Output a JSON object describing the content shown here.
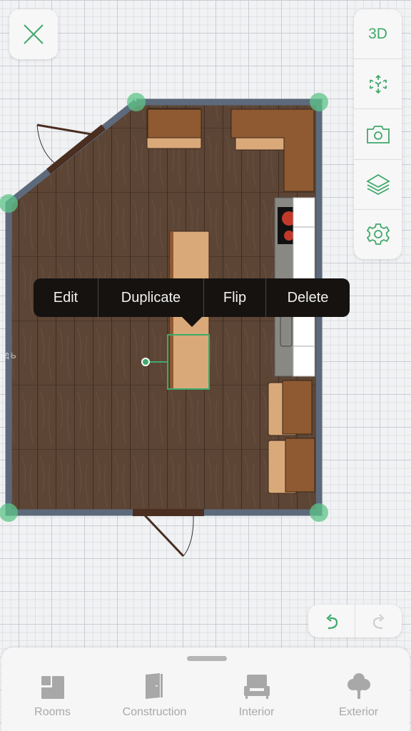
{
  "top_left": {
    "close_icon": "close-icon"
  },
  "toolbar": {
    "items": [
      {
        "label": "3D",
        "name": "view-3d"
      },
      {
        "icon": "move-3d-icon",
        "name": "transform"
      },
      {
        "icon": "camera-icon",
        "name": "snapshot"
      },
      {
        "icon": "layers-icon",
        "name": "layers"
      },
      {
        "icon": "gear-icon",
        "name": "settings"
      }
    ]
  },
  "floor_plan": {
    "wall_dimension_label": "15' 0\"",
    "colors": {
      "floor": "#5c4535",
      "wall": "#5d6a7b",
      "vertex": "#5ec48a",
      "cabinet_top": "#8f5a31",
      "counter": "#d9a97a",
      "selection": "#3fa96b"
    }
  },
  "context_menu": {
    "items": [
      "Edit",
      "Duplicate",
      "Flip",
      "Delete"
    ]
  },
  "history": {
    "undo_icon": "undo-icon",
    "redo_icon": "redo-icon",
    "undo_enabled": true,
    "redo_enabled": false
  },
  "bottom_tabs": [
    {
      "label": "Rooms",
      "icon": "rooms-icon"
    },
    {
      "label": "Construction",
      "icon": "door-icon"
    },
    {
      "label": "Interior",
      "icon": "armchair-icon"
    },
    {
      "label": "Exterior",
      "icon": "tree-icon"
    }
  ],
  "accent_color": "#3fa96b",
  "muted_color": "#a8a8a8"
}
